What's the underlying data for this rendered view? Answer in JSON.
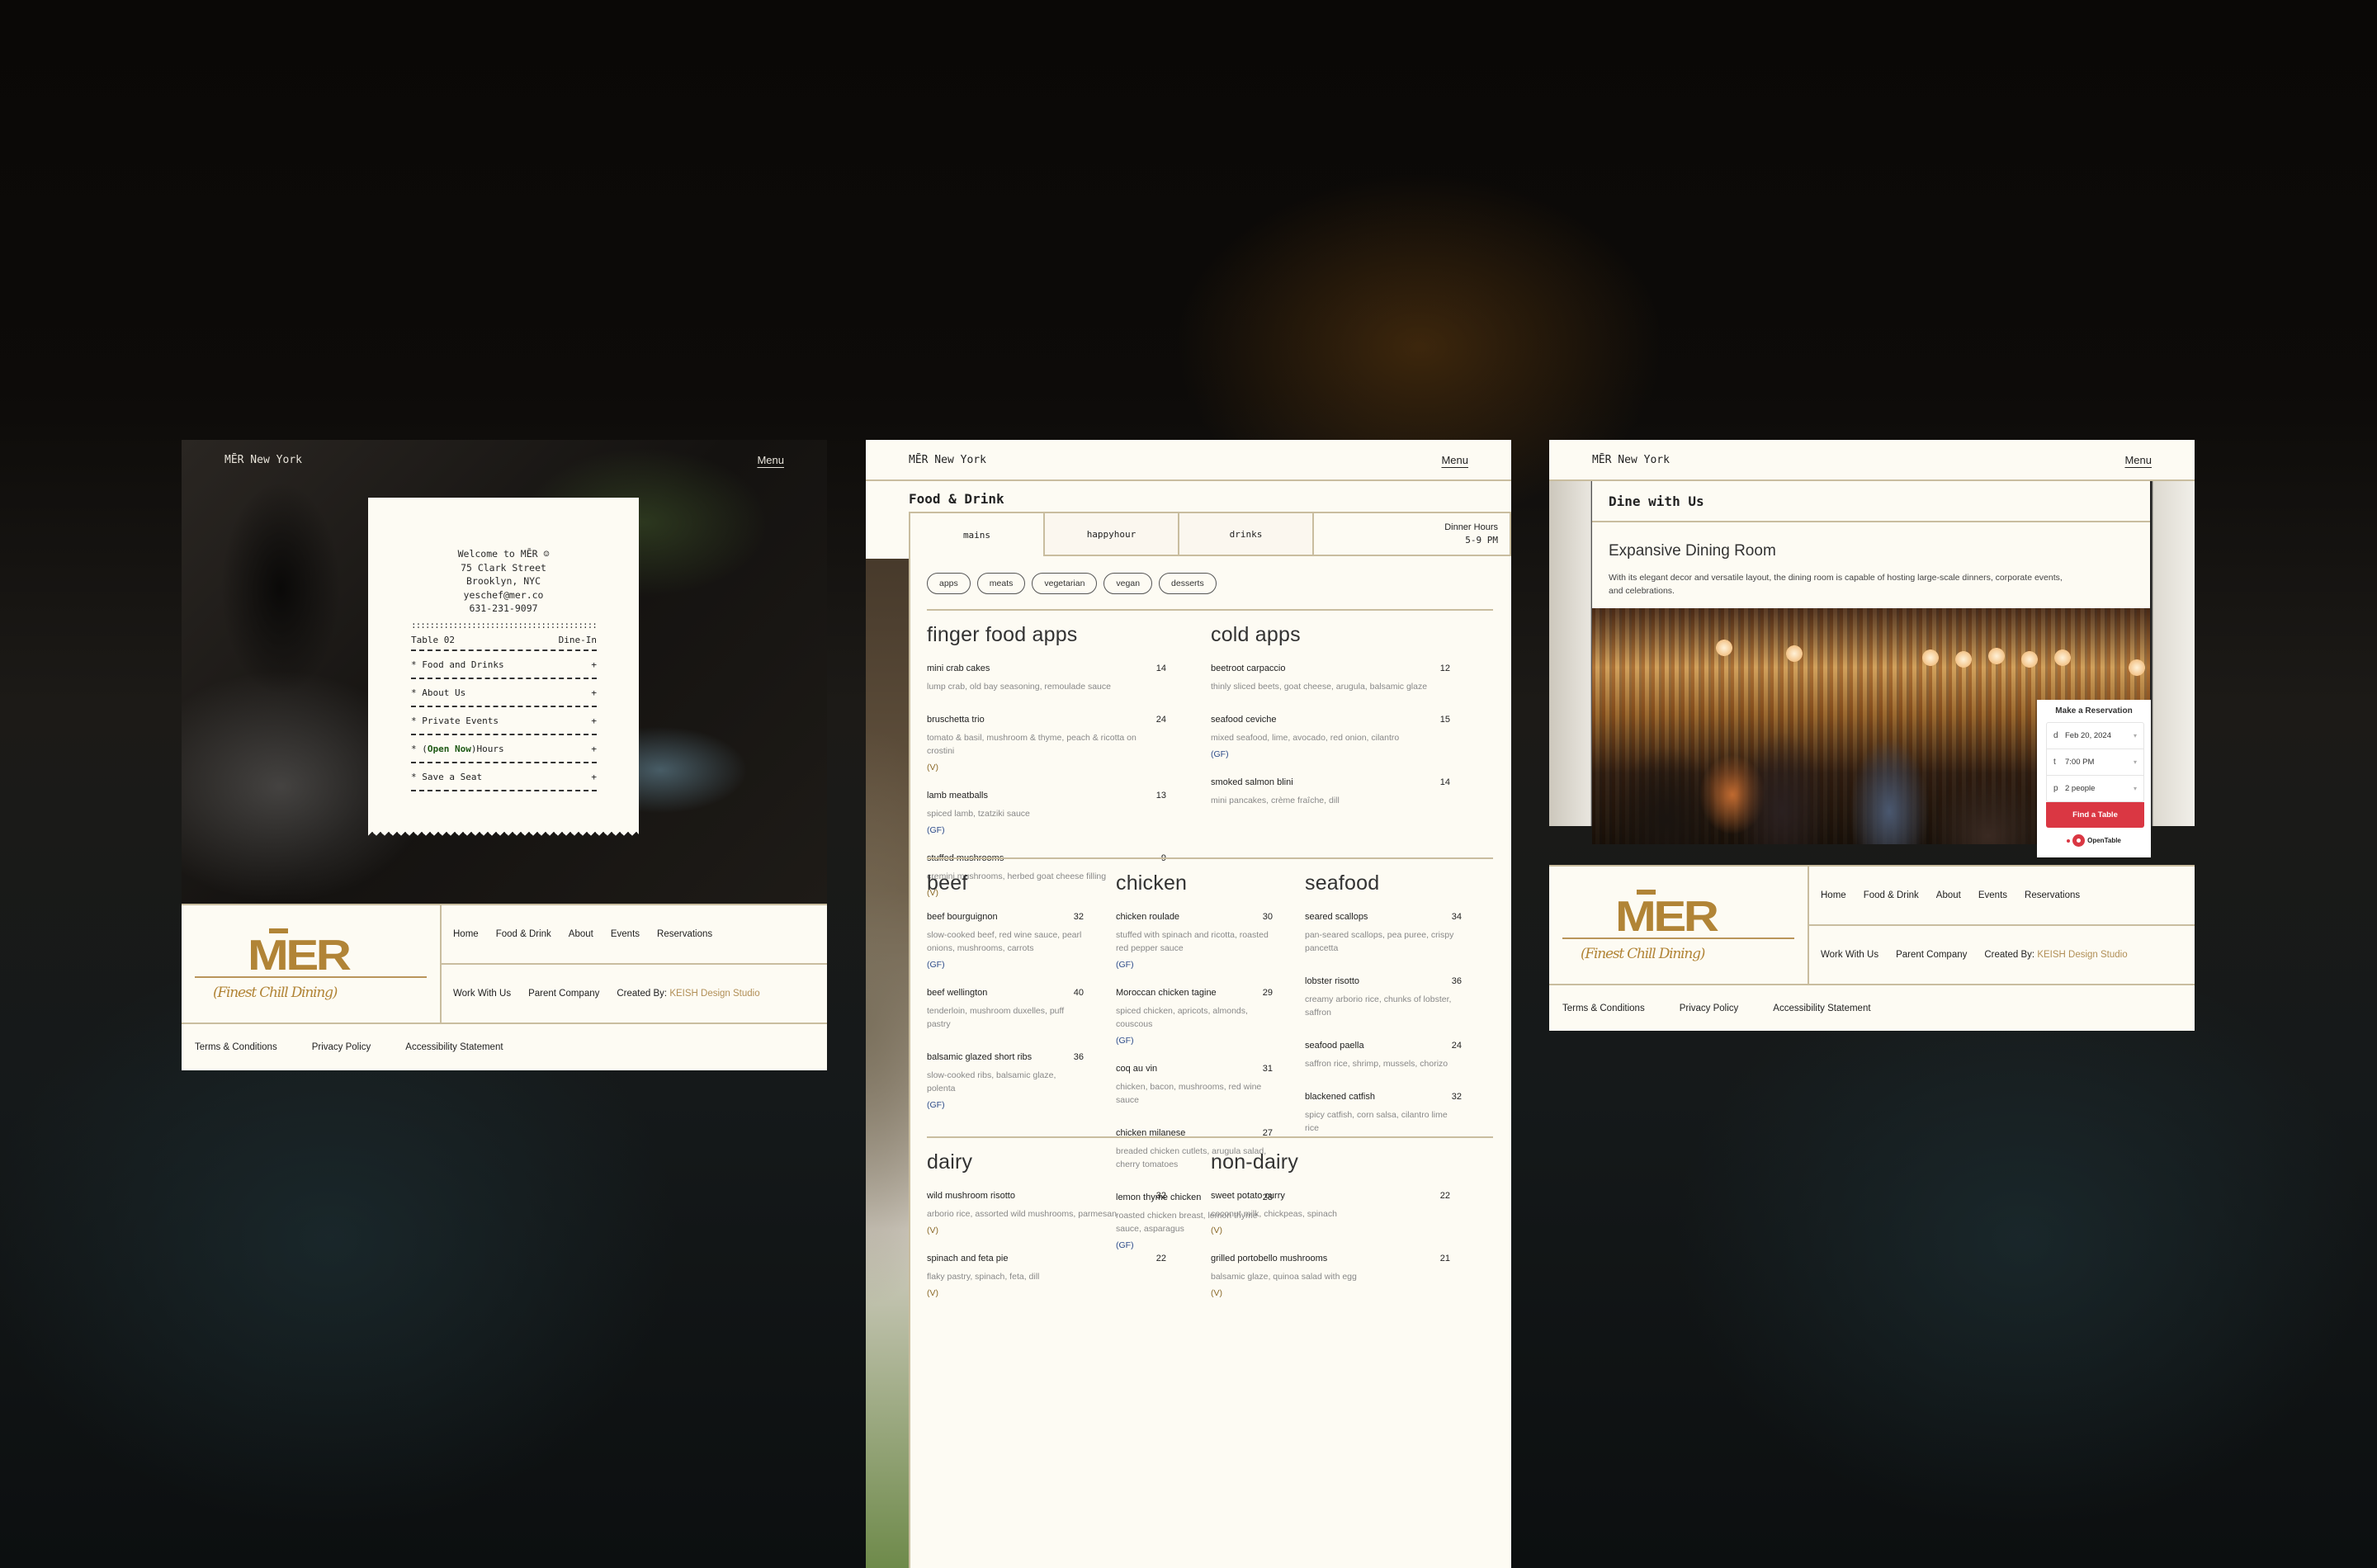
{
  "brand": "MĒR New York",
  "menu_label": "Menu",
  "home": {
    "receipt": {
      "address_lines": [
        "Welcome to MĒR ☺",
        "75 Clark Street",
        "Brooklyn, NYC",
        "yeschef@mer.co",
        "631-231-9097"
      ],
      "separator": "::::::::::::::::::::::::::::::::::::::::::::::::::::::::",
      "table": "Table 02",
      "service": "Dine-In",
      "items": [
        {
          "label": "Food and Drinks",
          "icon": "+"
        },
        {
          "label": "About Us",
          "icon": "+"
        },
        {
          "label": "Private Events",
          "icon": "+"
        },
        {
          "prefix": "(",
          "highlight": "Open Now",
          "suffix": ")Hours",
          "icon": "+"
        },
        {
          "label": "Save a Seat",
          "icon": "+"
        }
      ],
      "bullet": "*"
    }
  },
  "footer": {
    "logo": "MĒR",
    "logo_base": "MER",
    "tagline": "(Finest Chill Dining)",
    "nav": [
      "Home",
      "Food & Drink",
      "About",
      "Events",
      "Reservations"
    ],
    "secondary": [
      "Work With Us",
      "Parent Company"
    ],
    "created_by_label": "Created By:",
    "created_by_name": "KEISH Design Studio",
    "legal": [
      "Terms & Conditions",
      "Privacy Policy",
      "Accessibility Statement"
    ]
  },
  "menu_page": {
    "title": "Food & Drink",
    "tabs": [
      "mains",
      "happyhour",
      "drinks"
    ],
    "active_tab": "mains",
    "hours_label": "Dinner Hours",
    "hours_value": "5-9 PM",
    "filters": [
      "apps",
      "meats",
      "vegetarian",
      "vegan",
      "desserts"
    ],
    "sections": [
      {
        "categories": [
          {
            "name": "finger food apps",
            "items": [
              {
                "name": "mini crab cakes",
                "price": "14",
                "desc": "lump crab, old bay seasoning, remoulade sauce",
                "tag": ""
              },
              {
                "name": "bruschetta trio",
                "price": "24",
                "desc": "tomato & basil, mushroom & thyme, peach & ricotta on crostini",
                "tag": "(V)"
              },
              {
                "name": "lamb meatballs",
                "price": "13",
                "desc": "spiced lamb, tzatziki sauce",
                "tag": "(GF)"
              },
              {
                "name": "stuffed mushrooms",
                "price": "9",
                "desc": "cremini mushrooms, herbed goat cheese filling",
                "tag": "(V)"
              }
            ]
          },
          {
            "name": "cold apps",
            "items": [
              {
                "name": "beetroot carpaccio",
                "price": "12",
                "desc": "thinly sliced beets, goat cheese, arugula, balsamic glaze",
                "tag": ""
              },
              {
                "name": "seafood ceviche",
                "price": "15",
                "desc": "mixed seafood, lime, avocado, red onion, cilantro",
                "tag": "(GF)"
              },
              {
                "name": "smoked salmon blini",
                "price": "14",
                "desc": "mini pancakes, crème fraîche, dill",
                "tag": ""
              }
            ]
          }
        ]
      },
      {
        "categories": [
          {
            "name": "beef",
            "items": [
              {
                "name": "beef bourguignon",
                "price": "32",
                "desc": "slow-cooked beef, red wine sauce, pearl onions, mushrooms, carrots",
                "tag": "(GF)"
              },
              {
                "name": "beef wellington",
                "price": "40",
                "desc": "tenderloin, mushroom duxelles, puff pastry",
                "tag": ""
              },
              {
                "name": "balsamic glazed short ribs",
                "price": "36",
                "desc": "slow-cooked ribs, balsamic glaze, polenta",
                "tag": "(GF)"
              }
            ]
          },
          {
            "name": "chicken",
            "items": [
              {
                "name": "chicken roulade",
                "price": "30",
                "desc": "stuffed with spinach and ricotta, roasted red pepper sauce",
                "tag": "(GF)"
              },
              {
                "name": "Moroccan chicken tagine",
                "price": "29",
                "desc": "spiced chicken, apricots, almonds, couscous",
                "tag": "(GF)"
              },
              {
                "name": "coq au vin",
                "price": "31",
                "desc": "chicken, bacon, mushrooms, red wine sauce",
                "tag": ""
              },
              {
                "name": "chicken milanese",
                "price": "27",
                "desc": "breaded chicken cutlets, arugula salad, cherry tomatoes",
                "tag": ""
              },
              {
                "name": "lemon thyme chicken",
                "price": "28",
                "desc": "roasted chicken breast, lemon thyme sauce, asparagus",
                "tag": "(GF)"
              }
            ]
          },
          {
            "name": "seafood",
            "items": [
              {
                "name": "seared scallops",
                "price": "34",
                "desc": "pan-seared scallops, pea puree, crispy pancetta",
                "tag": ""
              },
              {
                "name": "lobster risotto",
                "price": "36",
                "desc": "creamy arborio rice, chunks of lobster, saffron",
                "tag": ""
              },
              {
                "name": "seafood paella",
                "price": "24",
                "desc": "saffron rice, shrimp, mussels, chorizo",
                "tag": ""
              },
              {
                "name": "blackened catfish",
                "price": "32",
                "desc": "spicy catfish, corn salsa, cilantro lime rice",
                "tag": ""
              }
            ]
          }
        ]
      },
      {
        "categories": [
          {
            "name": "dairy",
            "items": [
              {
                "name": "wild mushroom risotto",
                "price": "32",
                "desc": "arborio rice, assorted wild mushrooms, parmesan",
                "tag": "(V)"
              },
              {
                "name": "spinach and feta pie",
                "price": "22",
                "desc": "flaky pastry, spinach, feta, dill",
                "tag": "(V)"
              }
            ]
          },
          {
            "name": "non-dairy",
            "items": [
              {
                "name": "sweet potato curry",
                "price": "22",
                "desc": "coconut milk, chickpeas, spinach",
                "tag": "(V)"
              },
              {
                "name": "grilled portobello mushrooms",
                "price": "21",
                "desc": "balsamic glaze, quinoa salad with egg",
                "tag": "(V)"
              }
            ]
          }
        ]
      }
    ]
  },
  "dine_page": {
    "title": "Dine with Us",
    "subtitle": "Expansive Dining Room",
    "description": "With its elegant decor and versatile layout, the dining room is capable of hosting large-scale dinners, corporate events, and celebrations.",
    "reservation": {
      "title": "Make a Reservation",
      "fields": [
        {
          "key": "d",
          "value": "Feb 20, 2024"
        },
        {
          "key": "t",
          "value": "7:00 PM"
        },
        {
          "key": "p",
          "value": "2 people"
        }
      ],
      "button": "Find a Table",
      "provider": "OpenTable",
      "accent": "#da3743"
    }
  },
  "colors": {
    "cream": "#fdfbf3",
    "gold": "#b18436",
    "rule": "#c9bd9f",
    "veg": "#8a6a2a",
    "gf": "#2d4c8a"
  }
}
